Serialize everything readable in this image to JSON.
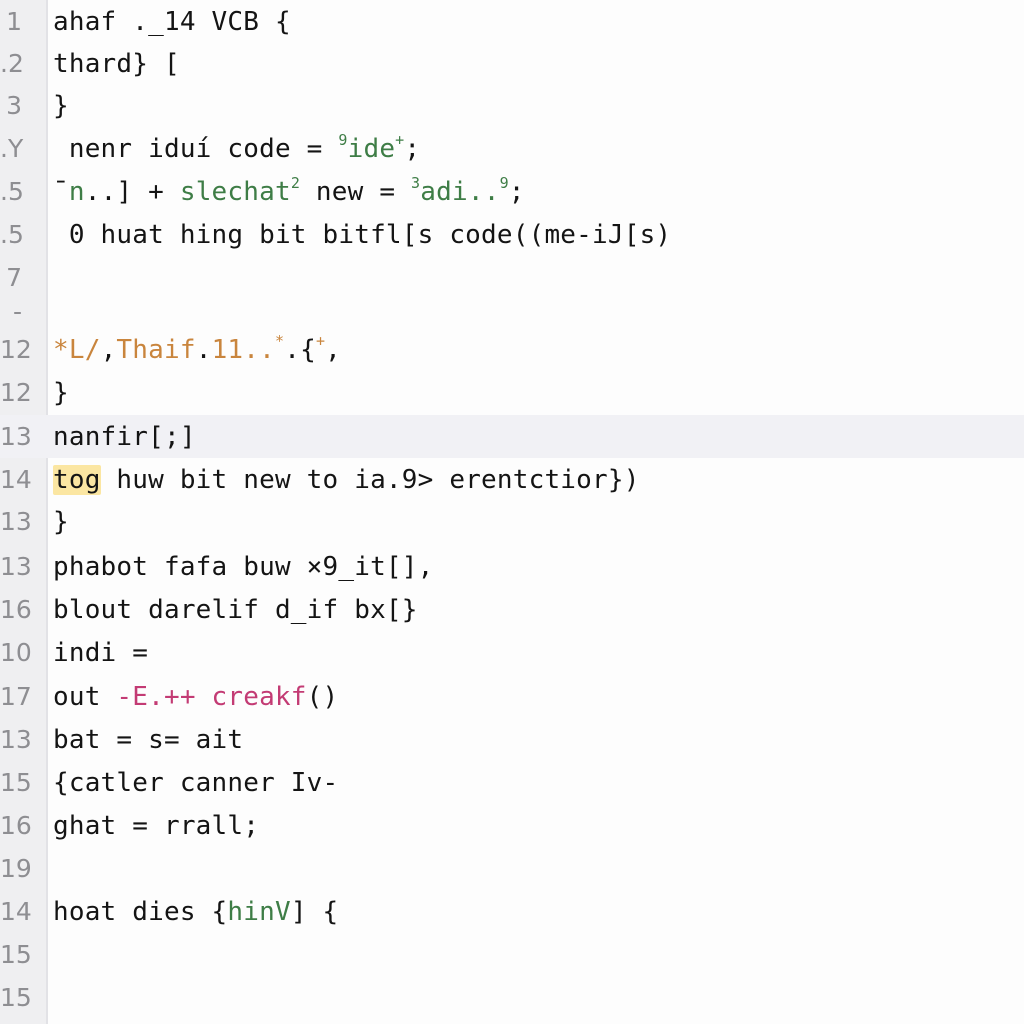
{
  "editor": {
    "current_line_index": 10,
    "colors": {
      "keyword_green": "#3e7d46",
      "string_orange": "#c9853d",
      "magenta": "#c33b74",
      "match_highlight": "#fbe6a2",
      "current_line": "#f1f1f5",
      "gutter": "#efeff1"
    },
    "lines": [
      {
        "num": "1",
        "text": "ahaf ._14 VCB {"
      },
      {
        "num": ".2",
        "text": "thard} ["
      },
      {
        "num": "3",
        "text": "}"
      },
      {
        "num": ".Y",
        "parts": [
          " nenr iduí code = ",
          {
            "sup": "9",
            "cls": "g"
          },
          {
            "t": "ide",
            "cls": "g"
          },
          {
            "sup": "+",
            "cls": "g"
          },
          ";"
        ]
      },
      {
        "num": ".5",
        "parts": [
          "¯",
          {
            "t": "n",
            "cls": "g"
          },
          "..] + ",
          {
            "t": "slechat",
            "cls": "g"
          },
          {
            "sup": "2",
            "cls": "g"
          },
          " new = ",
          {
            "sup": "3",
            "cls": "g"
          },
          {
            "t": "adi..",
            "cls": "g"
          },
          {
            "sup": "9",
            "cls": "g"
          },
          ";"
        ]
      },
      {
        "num": ".5",
        "text": " 0 huat hing bit bitfl[s code((me-iJ[s)"
      },
      {
        "num": "7",
        "text": ""
      },
      {
        "num": "-",
        "text": ""
      },
      {
        "num": "12",
        "parts": [
          {
            "t": "*L/",
            "cls": "o"
          },
          ",",
          {
            "t": "Thaif",
            "cls": "o"
          },
          ".",
          {
            "t": "11..",
            "cls": "o"
          },
          {
            "sup": "*",
            "cls": "o"
          },
          ".{",
          {
            "sup": "+",
            "cls": "o"
          },
          ","
        ]
      },
      {
        "num": "12",
        "text": "}"
      },
      {
        "num": "13",
        "text": "nanfir[;]"
      },
      {
        "num": "14",
        "parts": [
          {
            "t": "tog",
            "cls": "hl"
          },
          " huw bit new to ia.9> erentctior})"
        ]
      },
      {
        "num": "13",
        "text": "}"
      },
      {
        "num": "13",
        "text": "phabot fafa buw ×9_it[],"
      },
      {
        "num": "16",
        "text": "blout darelif d_if bx[}"
      },
      {
        "num": "10",
        "text": "indi ="
      },
      {
        "num": "17",
        "parts": [
          "out ",
          {
            "t": "-E.++ creakf",
            "cls": "m"
          },
          "()"
        ]
      },
      {
        "num": "13",
        "text": "bat = s= ait"
      },
      {
        "num": "15",
        "text": "{catler canner Iv-"
      },
      {
        "num": "16",
        "text": "ghat = rrall;"
      },
      {
        "num": "19",
        "text": ""
      },
      {
        "num": "14",
        "parts": [
          "hoat dies {",
          {
            "t": "hinV",
            "cls": "g"
          },
          "] {"
        ]
      },
      {
        "num": "15",
        "text": ""
      },
      {
        "num": "15",
        "text": ""
      }
    ]
  }
}
